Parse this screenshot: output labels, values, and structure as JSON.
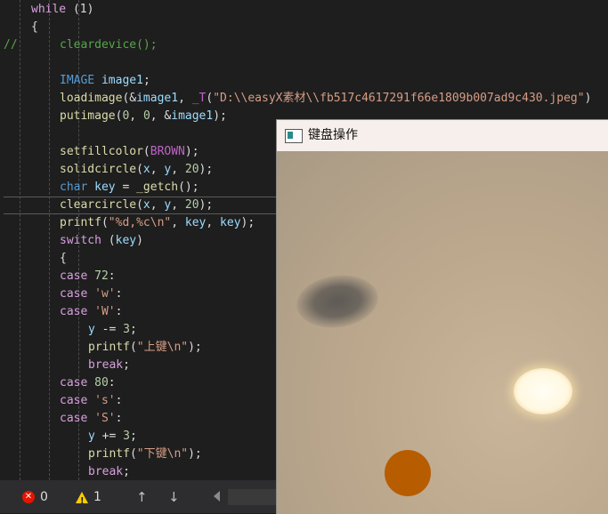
{
  "editor": {
    "lines": [
      {
        "tokens": [
          {
            "c": "kw",
            "t": "while"
          },
          {
            "c": "pl",
            "t": " (1)"
          }
        ]
      },
      {
        "tokens": [
          {
            "c": "pl",
            "t": "{"
          }
        ]
      },
      {
        "prefix": "//",
        "tokens": [
          {
            "c": "cm",
            "t": "cleardevice();"
          }
        ]
      },
      {
        "tokens": []
      },
      {
        "tokens": [
          {
            "c": "ty",
            "t": "IMAGE"
          },
          {
            "c": "pl",
            "t": " "
          },
          {
            "c": "vr",
            "t": "image1"
          },
          {
            "c": "pl",
            "t": ";"
          }
        ]
      },
      {
        "tokens": [
          {
            "c": "fn",
            "t": "loadimage"
          },
          {
            "c": "pl",
            "t": "(&"
          },
          {
            "c": "vr",
            "t": "image1"
          },
          {
            "c": "pl",
            "t": ", "
          },
          {
            "c": "mc",
            "t": "_T"
          },
          {
            "c": "pl",
            "t": "("
          },
          {
            "c": "st",
            "t": "\"D:\\\\easyX素材\\\\fb517c4617291f66e1809b007ad9c430.jpeg\""
          },
          {
            "c": "pl",
            "t": ")"
          }
        ]
      },
      {
        "tokens": [
          {
            "c": "fn",
            "t": "putimage"
          },
          {
            "c": "pl",
            "t": "("
          },
          {
            "c": "nm",
            "t": "0"
          },
          {
            "c": "pl",
            "t": ", "
          },
          {
            "c": "nm",
            "t": "0"
          },
          {
            "c": "pl",
            "t": ", &"
          },
          {
            "c": "vr",
            "t": "image1"
          },
          {
            "c": "pl",
            "t": ");"
          }
        ]
      },
      {
        "tokens": []
      },
      {
        "tokens": [
          {
            "c": "fn",
            "t": "setfillcolor"
          },
          {
            "c": "pl",
            "t": "("
          },
          {
            "c": "mc",
            "t": "BROWN"
          },
          {
            "c": "pl",
            "t": ");"
          }
        ]
      },
      {
        "tokens": [
          {
            "c": "fn",
            "t": "solidcircle"
          },
          {
            "c": "pl",
            "t": "("
          },
          {
            "c": "vr",
            "t": "x"
          },
          {
            "c": "pl",
            "t": ", "
          },
          {
            "c": "vr",
            "t": "y"
          },
          {
            "c": "pl",
            "t": ", "
          },
          {
            "c": "nm",
            "t": "20"
          },
          {
            "c": "pl",
            "t": ");"
          }
        ]
      },
      {
        "tokens": [
          {
            "c": "ty",
            "t": "char"
          },
          {
            "c": "pl",
            "t": " "
          },
          {
            "c": "vr",
            "t": "key"
          },
          {
            "c": "pl",
            "t": " = "
          },
          {
            "c": "fn",
            "t": "_getch"
          },
          {
            "c": "pl",
            "t": "();"
          }
        ]
      },
      {
        "current": true,
        "tokens": [
          {
            "c": "fn",
            "t": "clearcircle"
          },
          {
            "c": "pl",
            "t": "("
          },
          {
            "c": "vr",
            "t": "x"
          },
          {
            "c": "pl",
            "t": ", "
          },
          {
            "c": "vr",
            "t": "y"
          },
          {
            "c": "pl",
            "t": ", "
          },
          {
            "c": "nm",
            "t": "20"
          },
          {
            "c": "pl",
            "t": ");"
          }
        ]
      },
      {
        "tokens": [
          {
            "c": "fn",
            "t": "printf"
          },
          {
            "c": "pl",
            "t": "("
          },
          {
            "c": "st",
            "t": "\"%d,%c\\n\""
          },
          {
            "c": "pl",
            "t": ", "
          },
          {
            "c": "vr",
            "t": "key"
          },
          {
            "c": "pl",
            "t": ", "
          },
          {
            "c": "vr",
            "t": "key"
          },
          {
            "c": "pl",
            "t": ");"
          }
        ]
      },
      {
        "tokens": [
          {
            "c": "kw",
            "t": "switch"
          },
          {
            "c": "pl",
            "t": " ("
          },
          {
            "c": "vr",
            "t": "key"
          },
          {
            "c": "pl",
            "t": ")"
          }
        ]
      },
      {
        "tokens": [
          {
            "c": "pl",
            "t": "{"
          }
        ]
      },
      {
        "tokens": [
          {
            "c": "kw",
            "t": "case"
          },
          {
            "c": "pl",
            "t": " "
          },
          {
            "c": "nm",
            "t": "72"
          },
          {
            "c": "pl",
            "t": ":"
          }
        ]
      },
      {
        "tokens": [
          {
            "c": "kw",
            "t": "case"
          },
          {
            "c": "pl",
            "t": " "
          },
          {
            "c": "st",
            "t": "'w'"
          },
          {
            "c": "pl",
            "t": ":"
          }
        ]
      },
      {
        "tokens": [
          {
            "c": "kw",
            "t": "case"
          },
          {
            "c": "pl",
            "t": " "
          },
          {
            "c": "st",
            "t": "'W'"
          },
          {
            "c": "pl",
            "t": ":"
          }
        ]
      },
      {
        "tokens": [
          {
            "c": "vr",
            "t": "y"
          },
          {
            "c": "pl",
            "t": " -= "
          },
          {
            "c": "nm",
            "t": "3"
          },
          {
            "c": "pl",
            "t": ";"
          }
        ]
      },
      {
        "tokens": [
          {
            "c": "fn",
            "t": "printf"
          },
          {
            "c": "pl",
            "t": "("
          },
          {
            "c": "st",
            "t": "\"上键\\n\""
          },
          {
            "c": "pl",
            "t": ");"
          }
        ]
      },
      {
        "tokens": [
          {
            "c": "kw",
            "t": "break"
          },
          {
            "c": "pl",
            "t": ";"
          }
        ]
      },
      {
        "tokens": [
          {
            "c": "kw",
            "t": "case"
          },
          {
            "c": "pl",
            "t": " "
          },
          {
            "c": "nm",
            "t": "80"
          },
          {
            "c": "pl",
            "t": ":"
          }
        ]
      },
      {
        "tokens": [
          {
            "c": "kw",
            "t": "case"
          },
          {
            "c": "pl",
            "t": " "
          },
          {
            "c": "st",
            "t": "'s'"
          },
          {
            "c": "pl",
            "t": ":"
          }
        ]
      },
      {
        "tokens": [
          {
            "c": "kw",
            "t": "case"
          },
          {
            "c": "pl",
            "t": " "
          },
          {
            "c": "st",
            "t": "'S'"
          },
          {
            "c": "pl",
            "t": ":"
          }
        ]
      },
      {
        "tokens": [
          {
            "c": "vr",
            "t": "y"
          },
          {
            "c": "pl",
            "t": " += "
          },
          {
            "c": "nm",
            "t": "3"
          },
          {
            "c": "pl",
            "t": ";"
          }
        ]
      },
      {
        "tokens": [
          {
            "c": "fn",
            "t": "printf"
          },
          {
            "c": "pl",
            "t": "("
          },
          {
            "c": "st",
            "t": "\"下键\\n\""
          },
          {
            "c": "pl",
            "t": ");"
          }
        ]
      },
      {
        "tokens": [
          {
            "c": "kw",
            "t": "break"
          },
          {
            "c": "pl",
            "t": ";"
          }
        ]
      }
    ]
  },
  "statusbar": {
    "errors": "0",
    "warnings": "1",
    "up_arrow": "↑",
    "down_arrow": "↓"
  },
  "window": {
    "title": "键盘操作"
  }
}
